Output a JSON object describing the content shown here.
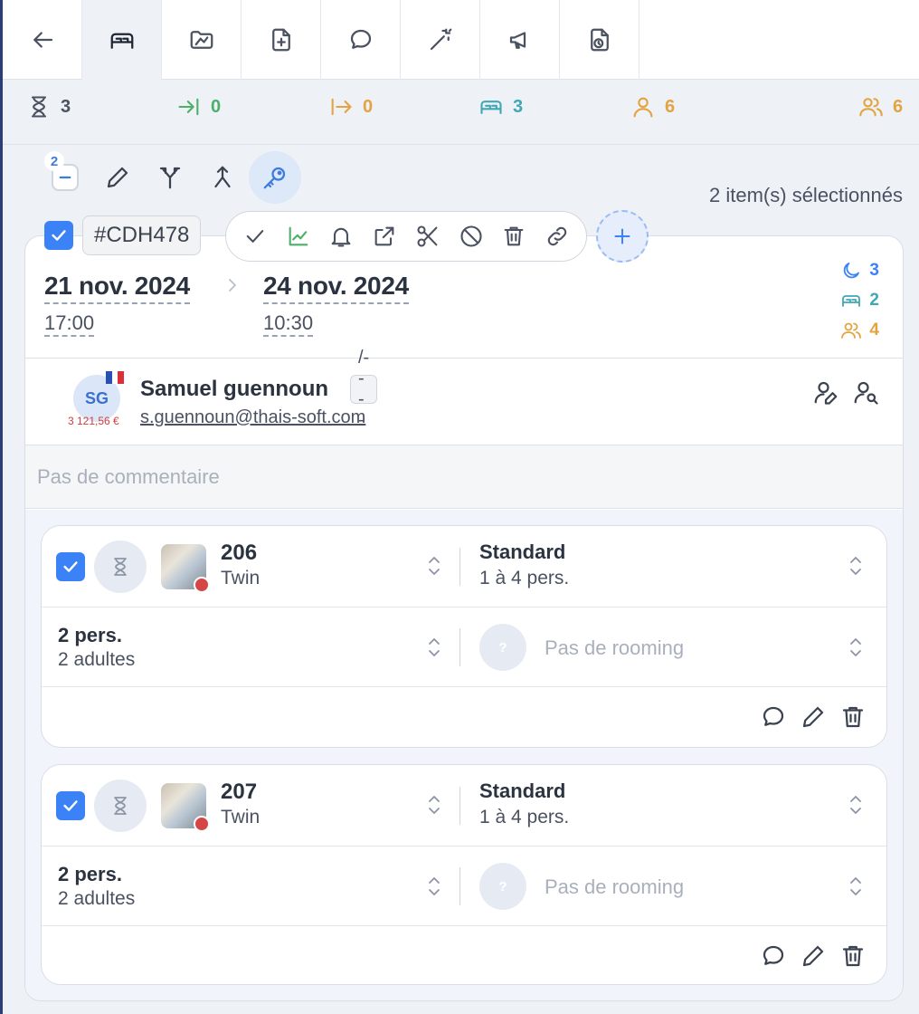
{
  "tabs": [
    {
      "icon": "back-arrow-icon"
    },
    {
      "icon": "bed-icon",
      "active": true
    },
    {
      "icon": "folder-icon"
    },
    {
      "icon": "file-add-icon"
    },
    {
      "icon": "chat-icon"
    },
    {
      "icon": "magic-wand-icon"
    },
    {
      "icon": "megaphone-icon"
    },
    {
      "icon": "document-clock-icon"
    }
  ],
  "stats": {
    "pending": {
      "value": "3",
      "color": "#4a5160"
    },
    "arrivals": {
      "value": "0",
      "color": "#4caf6a"
    },
    "departures": {
      "value": "0",
      "color": "#e3a340"
    },
    "rooms": {
      "value": "3",
      "color": "#3fa7b5"
    },
    "guests": {
      "value": "6",
      "color": "#e3a340"
    },
    "group": {
      "value": "6",
      "color": "#e3a340"
    }
  },
  "toolbar": {
    "selected_count": "2",
    "selected_text": "2 item(s) sélectionnés"
  },
  "booking": {
    "reference": "#CDH478",
    "arrival_date": "21 nov. 2024",
    "arrival_time": "17:00",
    "departure_date": "24 nov. 2024",
    "departure_time": "10:30",
    "nights": "3",
    "rooms": "2",
    "persons": "4",
    "accent": "#3b82f6"
  },
  "guest": {
    "initials": "SG",
    "balance": "3 121,56 €",
    "name": "Samuel guennoun",
    "code": "/----",
    "email": "s.guennoun@thais-soft.com"
  },
  "comment_placeholder": "Pas de commentaire",
  "rooms": [
    {
      "number": "206",
      "type": "Twin",
      "category": "Standard",
      "capacity": "1 à 4 pers.",
      "persons": "2 pers.",
      "adults": "2 adultes",
      "rooming_icon": "?",
      "rooming": "Pas de rooming"
    },
    {
      "number": "207",
      "type": "Twin",
      "category": "Standard",
      "capacity": "1 à 4 pers.",
      "persons": "2 pers.",
      "adults": "2 adultes",
      "rooming_icon": "?",
      "rooming": "Pas de rooming"
    }
  ]
}
